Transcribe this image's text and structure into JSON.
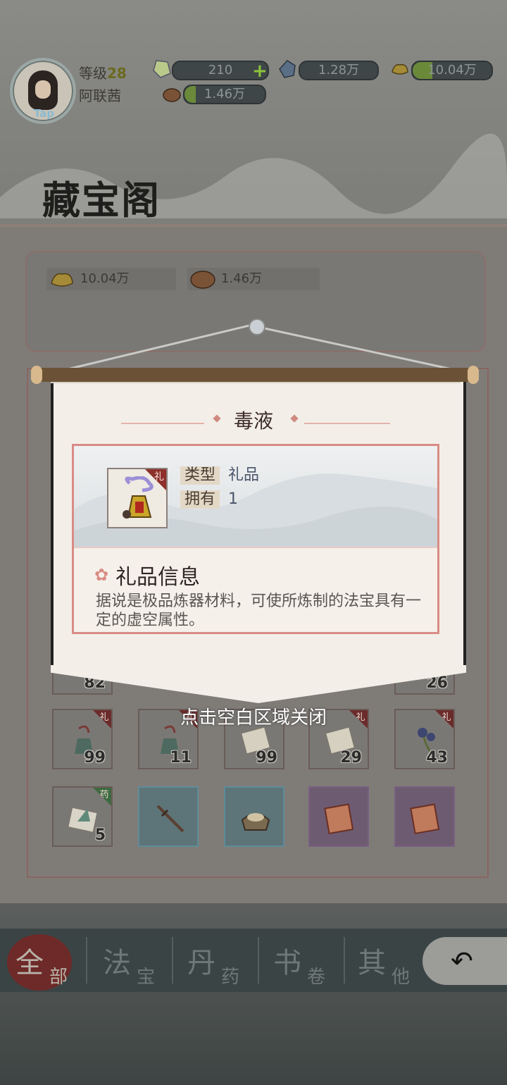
{
  "player": {
    "level_label": "等级",
    "level": "28",
    "name": "阿联茜",
    "avatar_badge": "Tap"
  },
  "resources": {
    "gem": "210",
    "crystal": "1.28万",
    "gold": "10.04万",
    "ore": "1.46万"
  },
  "page_title": "藏宝阁",
  "shop_resources": {
    "gold": "10.04万",
    "ore": "1.46万"
  },
  "inventory": {
    "row0_counts": [
      "82",
      "26"
    ],
    "row1": [
      {
        "tag": "礼",
        "icon": "bell-pendant-icon",
        "count": "99"
      },
      {
        "tag": "礼",
        "icon": "bell-pendant-icon",
        "count": "11"
      },
      {
        "tag": "",
        "icon": "scroll-icon",
        "count": "99"
      },
      {
        "tag": "礼",
        "icon": "scroll-icon",
        "count": "29"
      },
      {
        "tag": "礼",
        "icon": "flower-icon",
        "count": "43"
      }
    ],
    "row2": [
      {
        "tag": "药",
        "icon": "herb-leaf-icon",
        "count": "5"
      },
      {
        "tag": "",
        "icon": "sword-icon",
        "count": ""
      },
      {
        "tag": "",
        "icon": "rice-bag-icon",
        "count": ""
      },
      {
        "tag": "",
        "icon": "manual-book-icon",
        "count": ""
      },
      {
        "tag": "",
        "icon": "manual-book-icon",
        "count": ""
      }
    ]
  },
  "tabs": [
    {
      "big": "全",
      "small": "部",
      "active": true
    },
    {
      "big": "法",
      "small": "宝",
      "active": false
    },
    {
      "big": "丹",
      "small": "药",
      "active": false
    },
    {
      "big": "书",
      "small": "卷",
      "active": false
    },
    {
      "big": "其",
      "small": "他",
      "active": false
    }
  ],
  "popup": {
    "item_name": "毒液",
    "item_tag": "礼",
    "type_label": "类型",
    "type_value": "礼品",
    "own_label": "拥有",
    "own_value": "1",
    "section_title": "礼品信息",
    "description": "据说是极品炼器材料，可使所炼制的法宝具有一定的虚空属性。",
    "close_hint": "点击空白区域关闭"
  },
  "colors": {
    "accent_red": "#d98c84",
    "active_tab": "#6e2a28",
    "scroll_paper": "#f3efe8"
  }
}
